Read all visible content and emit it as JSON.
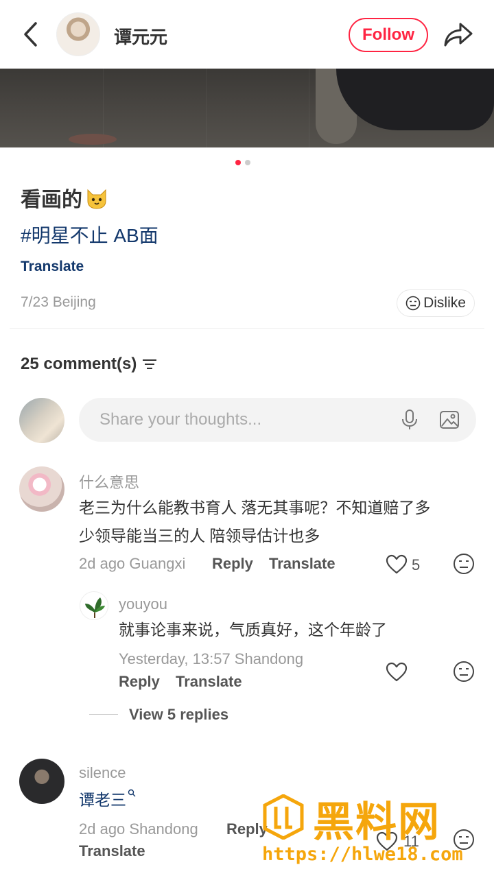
{
  "header": {
    "author_name": "谭元元",
    "follow_label": "Follow"
  },
  "post": {
    "title": "看画的",
    "hashtag": "#明星不止 AB面",
    "translate_label": "Translate",
    "date_location": "7/23 Beijing",
    "dislike_label": "Dislike",
    "image_count": 2,
    "current_image": 1
  },
  "comments_header": {
    "count_label": "25 comment(s)"
  },
  "composer": {
    "placeholder": "Share your thoughts..."
  },
  "comments": [
    {
      "user": "什么意思",
      "text_line1": "老三为什么能教书育人 落无其事呢？不知道赔了多",
      "text_line2": "少领导能当三的人 陪领导估计也多",
      "meta": "2d ago Guangxi",
      "reply_label": "Reply",
      "translate_label": "Translate",
      "likes": "5"
    },
    {
      "user": "youyou",
      "text": "就事论事来说，气质真好，这个年龄了",
      "meta": "Yesterday, 13:57 Shandong",
      "reply_label": "Reply",
      "translate_label": "Translate"
    },
    {
      "user": "silence",
      "text": "谭老三",
      "meta": "2d ago Shandong",
      "reply_label": "Reply",
      "translate_label": "Translate",
      "likes": "11"
    }
  ],
  "view_replies_label": "View 5 replies",
  "watermark": {
    "brand": "黑料网",
    "url": "https://hlwe18.com"
  },
  "colors": {
    "accent": "#ff2442",
    "link": "#13386c",
    "watermark": "#f5a60c"
  }
}
